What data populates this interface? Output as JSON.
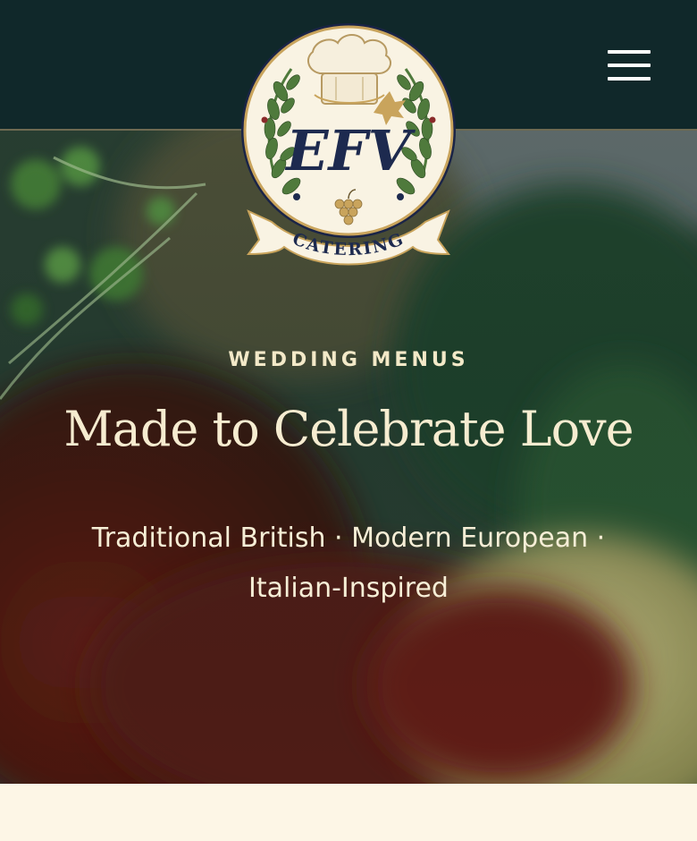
{
  "header": {
    "background": "#10282a",
    "menu_icon": "hamburger-menu-icon"
  },
  "logo": {
    "monogram": "EFV",
    "banner_text": "CATERING",
    "icons": [
      "chef-hat-icon",
      "laurel-wreath-icon",
      "grape-cluster-icon",
      "vine-leaf-icon"
    ]
  },
  "hero": {
    "eyebrow": "WEDDING MENUS",
    "headline": "Made to Celebrate Love",
    "subline": "Traditional British · Modern European · Italian-Inspired"
  },
  "colors": {
    "accent_gold": "#c9a45c",
    "navy": "#1d2a4f",
    "cream": "#fdf6e6",
    "hero_text": "#f6ecd0"
  }
}
